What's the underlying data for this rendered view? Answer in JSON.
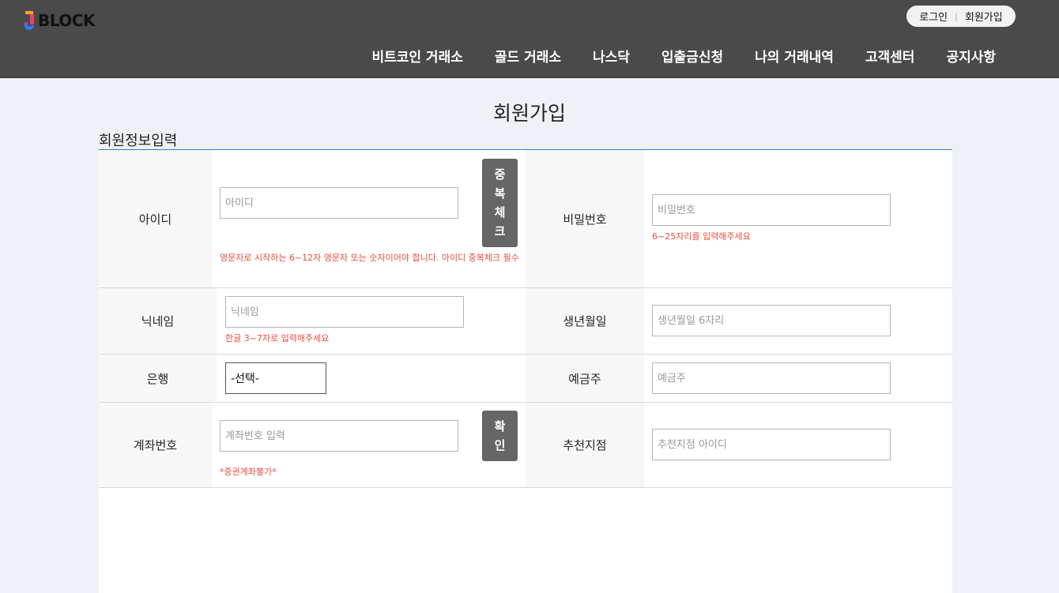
{
  "header": {
    "logo_text": "BLOCK",
    "auth": {
      "login": "로그인",
      "signup": "회원가입"
    },
    "nav": [
      "비트코인 거래소",
      "골드 거래소",
      "나스닥",
      "입출금신청",
      "나의 거래내역",
      "고객센터",
      "공지사항"
    ]
  },
  "page": {
    "title": "회원가입",
    "section_title": "회원정보입력"
  },
  "form": {
    "id": {
      "label": "아이디",
      "placeholder": "아이디",
      "check_button": [
        "중",
        "복",
        "체",
        "크"
      ],
      "hint": "영문자로 시작하는 6~12자 영문자 또는 숫자이어야 합니다. 아이디 중복체크 필수"
    },
    "password": {
      "label": "비밀번호",
      "placeholder": "비밀번호",
      "hint": "6~25자리를 입력해주세요"
    },
    "nickname": {
      "label": "닉네임",
      "placeholder": "닉네임",
      "hint": "한글 3~7자로 입력해주세요"
    },
    "birth": {
      "label": "생년월일",
      "placeholder": "생년월일 6자리"
    },
    "bank": {
      "label": "은행",
      "selected": "-선택-"
    },
    "holder": {
      "label": "예금주",
      "placeholder": "예금주"
    },
    "account": {
      "label": "계좌번호",
      "placeholder": "계좌번호 입력",
      "confirm_button": [
        "확",
        "인"
      ],
      "hint": "*증권계좌불가*"
    },
    "referrer": {
      "label": "추천지점",
      "placeholder": "추천지점 아이디"
    }
  },
  "colors": {
    "header_bg": "#4a4a4a",
    "hint": "#e74c3c",
    "button_bg": "#666666",
    "accent_rule": "#3a78c8"
  }
}
